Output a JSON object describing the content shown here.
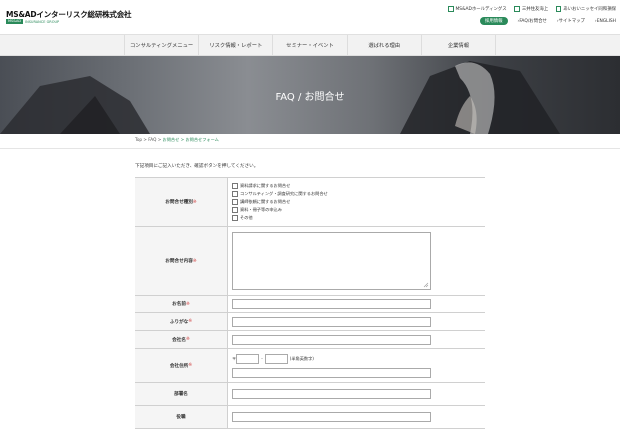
{
  "header": {
    "logo_main": "MS&ADインターリスク総研株式会社",
    "logo_badge": "MS&AD",
    "logo_group": "INSURANCE GROUP",
    "links": [
      "MS&ADホールディングス",
      "三井住友海上",
      "あいおいニッセイ同和損保"
    ],
    "recruit": "採用情報",
    "links2": [
      "FAQ/お問合せ",
      "サイトマップ",
      "ENGLISH"
    ],
    "link_prefix": "›"
  },
  "gnav": [
    "コンサルティングメニュー",
    "リスク情報・レポート",
    "セミナー・イベント",
    "選ばれる理由",
    "企業情報"
  ],
  "hero": {
    "title": "FAQ / お問合せ"
  },
  "breadcrumb": {
    "top": "Top",
    "sep": " > ",
    "faq": "FAQ",
    "current": "お問合せ > お問合せフォーム"
  },
  "intro": "下記項目にご記入いただき、確認ボタンを押してください。",
  "form": {
    "required_mark": "※",
    "type_label": "お問合せ種別",
    "type_options": [
      "資料請求に関するお問合せ",
      "コンサルティング・調査研究に関するお問合せ",
      "講師依頼に関するお問合せ",
      "資料・冊子等の申込み",
      "その他"
    ],
    "content_label": "お問合せ内容",
    "name_label": "お名前",
    "kana_label": "ふりがな",
    "company_label": "会社名",
    "address_label": "会社住所",
    "zip_prefix": "〒",
    "zip_dash": "-",
    "zip_note": "(半角英数字)",
    "dept_label": "部署名",
    "title_label": "役職"
  },
  "colors": {
    "brand": "#2a8a5a",
    "required": "#d04040"
  }
}
